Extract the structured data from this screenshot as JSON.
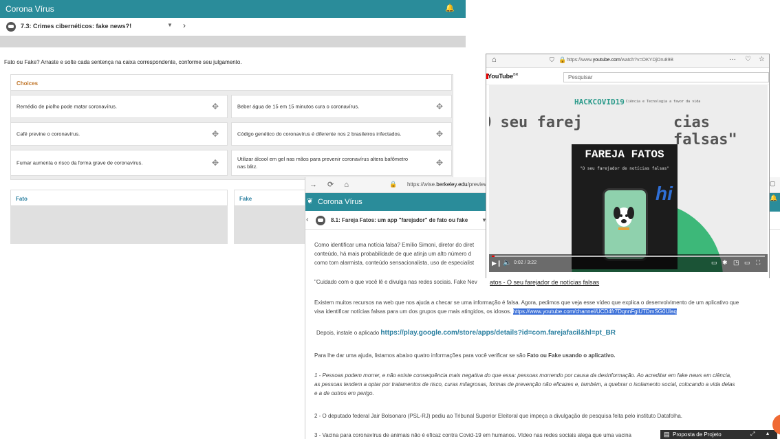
{
  "left": {
    "app_title": "Corona Vírus",
    "step_label": "7.3: Crimes cibernéticos: fake news?!",
    "instruction": "Fato ou Fake? Arraste e solte cada sentença na caixa correspondente, conforme seu julgamento.",
    "choices_header": "Choices",
    "choices": [
      "Remédio de piolho pode matar coronavírus.",
      "Beber água de 15 em 15 minutos cura o coronavírus.",
      "Café previne o coronavírus.",
      "Código genético do coronavírus é diferente nos 2 brasileiros infectados.",
      "Fumar aumenta o risco da forma grave de coronavírus.",
      "Utilizar álcool em gel nas mãos para prevenir coronavírus altera bafômetro nas blitz."
    ],
    "fato_label": "Fato",
    "fake_label": "Fake"
  },
  "bottom": {
    "url_prefix": "https://wise.",
    "url_bold": "berkeley.edu",
    "url_suffix": "/preview/",
    "app_title": "Corona Vírus",
    "step_label": "8.1: Fareja Fatos: um app \"farejador\" de fato ou fake",
    "para1_line1": "Como identificar uma notícia falsa? Emílio Simoni, diretor do diret",
    "para1_line2": "conteúdo, há mais probabilidade de que atinja um alto número d",
    "para1_line3": "como tom alarmista, conteúdo sensacionalista, uso de especialist",
    "para2": "\"Cuidado com o que você lê e divulga nas redes sociais. Fake Nev",
    "para3_line1": "Existem muitos recursos na web que nos ajuda a checar se uma informação é falsa. Agora, pedimos que veja esse vídeo que explica o desenvolvimento de um aplicativo que",
    "para3_line2": "visa identificar notícias falsas para um dos grupos que mais atingidos, os idosos.",
    "para3_link": "https://www.youtube.com/channel/UCD4fr7DqnnFgiUTDmSG0Ulaq",
    "para4_prefix": "Depois, instale o aplicado",
    "para4_link": "https://play.google.com/store/apps/details?id=com.farejafacil&hl=pt_BR",
    "para5_prefix": "Para lhe dar uma ajuda, listamos abaixo quatro informações para você verificar se são",
    "para5_bold": "Fato ou Fake usando o aplicativo.",
    "item1_line1": "1 - Pessoas podem morrer, e não existe consequência mais negativa do que essa: pessoas morrendo por causa da desinformação. Ao acreditar em fake news em ciência,",
    "item1_line2": "as pessoas tendem a optar por tratamentos de risco, curas milagrosas, formas de prevenção não eficazes e, também, a quebrar o isolamento social, colocando a vida delas",
    "item1_line3": "e a de outros em perigo.",
    "item2": "2 - O deputado federal Jair Bolsonaro (PSL-RJ) pediu ao Tribunal Superior Eleitoral que impeça a divulgação de pesquisa feita pelo instituto Datafolha.",
    "item3": "3 - Vacina para coronavírus de animais não é eficaz contra Covid-19 em humanos. Vídeo nas redes sociais alega que uma vacina",
    "proposta_label": "Proposta de Projeto"
  },
  "youtube": {
    "url_prefix": "https://www.",
    "url_bold": "youtube.com",
    "url_suffix": "/watch?v=OKYDjOru89B",
    "logo": "YouTube",
    "logo_sup": "BR",
    "search_placeholder": "Pesquisar",
    "ghost_left": "O seu farej",
    "ghost_right": "cias falsas\"",
    "brand": "HACKCOVID19",
    "brand_small": "Ciência e Tecnologia a favor da vida",
    "video_title": "FAREJA FATOS",
    "video_subtitle": "\"O seu farejador de notícias falsas\"",
    "hi_text": "hi",
    "time": "0:02 / 3:22",
    "progress_fraction": 0.01,
    "caption_underline": "atos - O seu farejador de notícias falsas"
  }
}
